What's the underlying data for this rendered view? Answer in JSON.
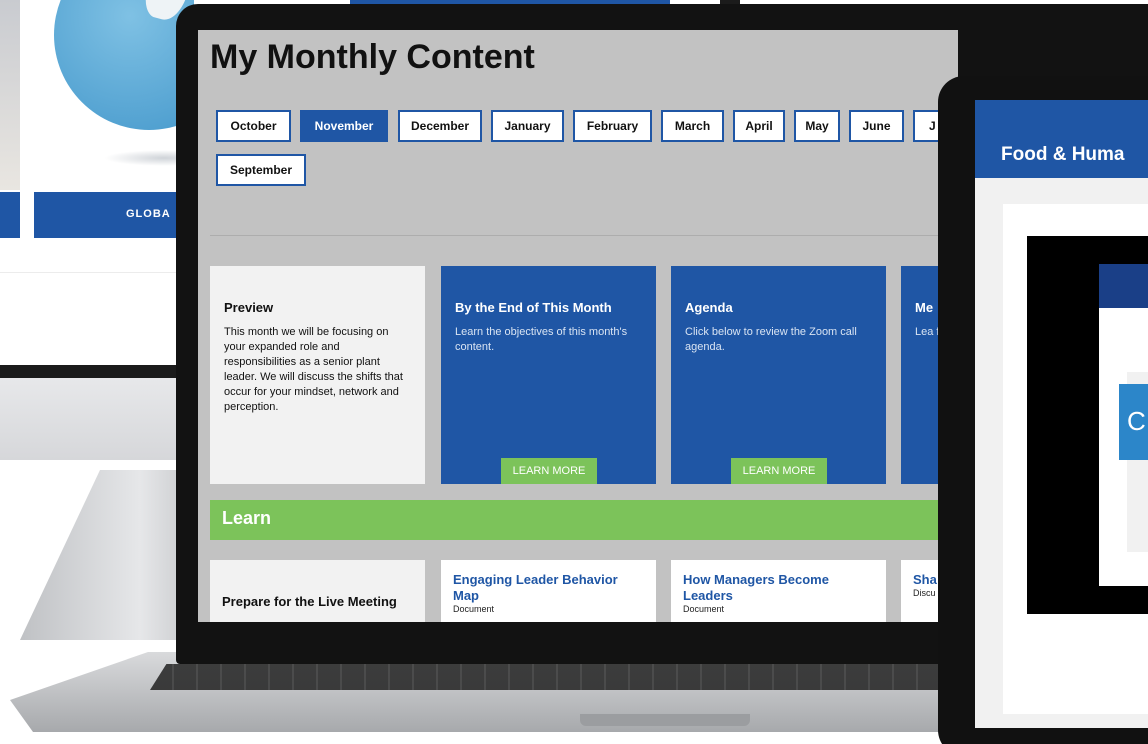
{
  "background_monitor": {
    "globe_banner_label": "GLOBA"
  },
  "laptop": {
    "page_title": "My Monthly Content",
    "months": [
      {
        "label": "October",
        "active": false
      },
      {
        "label": "November",
        "active": true
      },
      {
        "label": "December",
        "active": false
      },
      {
        "label": "January",
        "active": false
      },
      {
        "label": "February",
        "active": false
      },
      {
        "label": "March",
        "active": false
      },
      {
        "label": "April",
        "active": false
      },
      {
        "label": "May",
        "active": false
      },
      {
        "label": "June",
        "active": false
      },
      {
        "label": "J",
        "active": false
      },
      {
        "label": "September",
        "active": false
      }
    ],
    "cards": {
      "preview": {
        "title": "Preview",
        "body": "This month we will be focusing on your expanded role and responsibilities as a senior plant leader. We will discuss the shifts that occur for your mindset, network and perception."
      },
      "end_of_month": {
        "title": "By the End of This Month",
        "body": "Learn the objectives of this month's content.",
        "button": "LEARN MORE"
      },
      "agenda": {
        "title": "Agenda",
        "body": "Click below to review the Zoom call agenda.",
        "button": "LEARN MORE"
      },
      "partial": {
        "title": "Me",
        "body": "Lea for"
      }
    },
    "learn_section": {
      "title": "Learn",
      "prep_label": "Prepare for the Live Meeting",
      "resources": [
        {
          "title": "Engaging Leader Behavior Map",
          "type": "Document"
        },
        {
          "title": "How Managers Become Leaders",
          "type": "Document"
        },
        {
          "title": "Sha",
          "type": "Discu"
        }
      ]
    }
  },
  "tablet": {
    "header_title": "Food & Huma",
    "slide_badge": "C"
  },
  "colors": {
    "brand_blue": "#1f56a5",
    "accent_green": "#7cc35a",
    "page_gray": "#c2c2c2"
  }
}
